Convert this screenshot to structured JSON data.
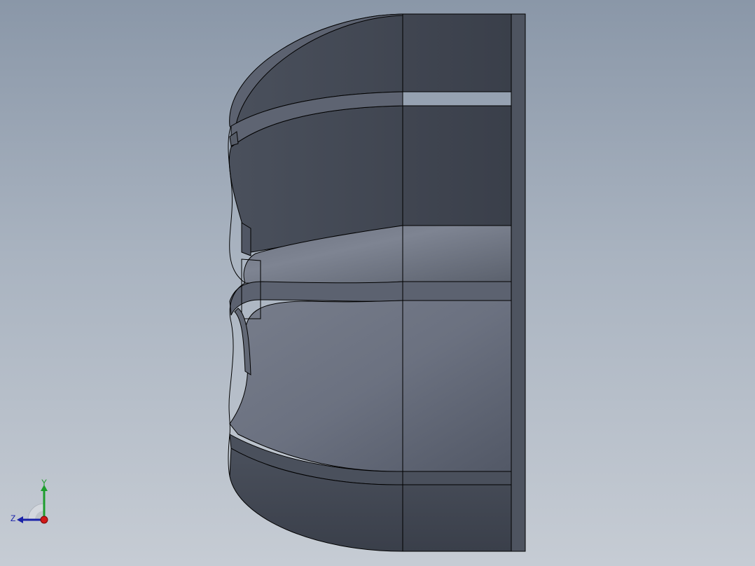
{
  "viewport": {
    "background_top": "#8a97a8",
    "background_bottom": "#c6ccd4"
  },
  "model": {
    "face_dark": "#3c414c",
    "face_mid": "#5a606c",
    "face_light": "#7c8290",
    "edge_color": "#000000"
  },
  "triad": {
    "y_label": "Y",
    "z_label": "Z",
    "y_color": "#1e9e2e",
    "z_color": "#1a22a8",
    "x_color": "#d01818"
  }
}
